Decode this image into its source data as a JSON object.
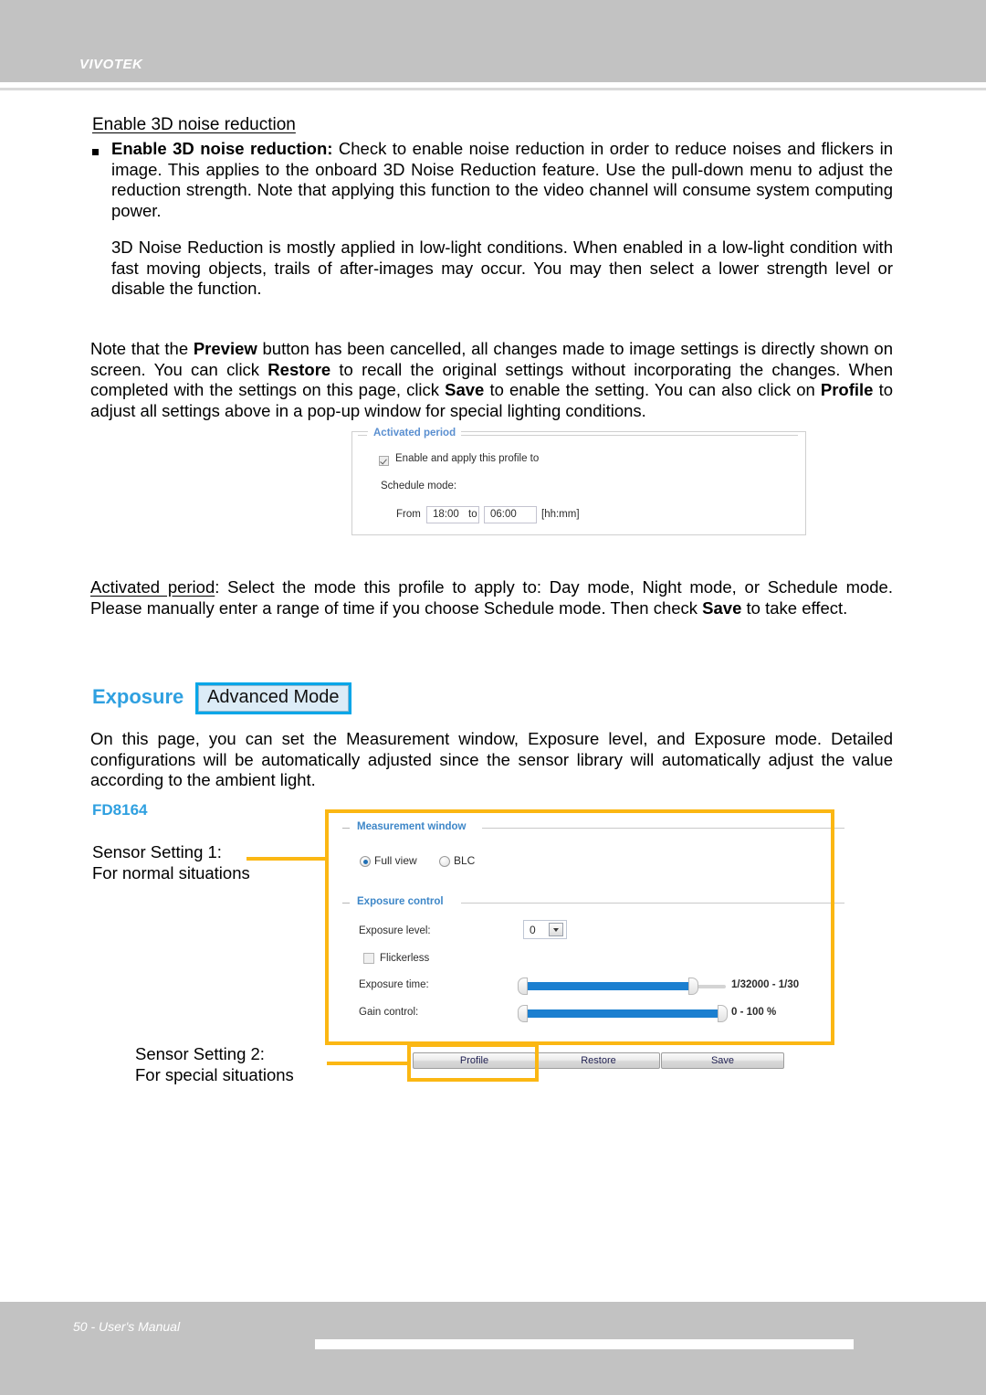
{
  "header": {
    "brand": "VIVOTEK"
  },
  "colors": {
    "header_gray": "#c2c2c2",
    "accent_blue": "#2fa0e0",
    "fieldset_blue": "#3e87c8",
    "annotation_yellow": "#fbb713",
    "slider_blue": "#1b7fd0",
    "badge_blue": "#00a6e8"
  },
  "content": {
    "section_heading": "Enable 3D noise reduction",
    "bullet_paragraph_lead": "Enable 3D noise reduction:",
    "bullet_paragraph_rest": " Check to enable noise reduction in order to reduce noises and flickers in image. This applies to the onboard 3D Noise Reduction feature. Use the pull-down menu to adjust the reduction strength. Note that applying this function to the video channel will consume system computing power.",
    "noise_reduction_paragraph": "3D Noise Reduction is mostly applied in low-light conditions. When enabled in a low-light condition with fast moving objects, trails of after-images may occur. You may then select a lower strength level or disable the function.",
    "note_paragraph": {
      "t1": "Note that the ",
      "b1": "Preview",
      "t2": " button has been cancelled, all changes made to image settings is directly shown on screen. You can click ",
      "b2": "Restore",
      "t3": " to recall the original settings without incorporating the changes. When completed with the settings on this page, click ",
      "b3": "Save",
      "t4": " to enable the setting. You can also click on ",
      "b4": "Profile",
      "t5": " to adjust all settings above in a pop-up window for special lighting conditions."
    },
    "activated_period_paragraph": {
      "u1": "Activated period",
      "t1": ": Select the mode this profile to apply to: Day mode, Night mode, or Schedule mode. Please manually enter a range of time if you choose Schedule mode. Then check ",
      "b1": "Save",
      "t2": " to take effect."
    },
    "exposure_paragraph": "On this page, you can set the Measurement window, Exposure level, and Exposure mode. Detailed configurations will be automatically adjusted since the sensor library will automatically adjust the value according to the ambient light."
  },
  "activated_period_dialog": {
    "legend": "Activated period",
    "enable_checkbox_label": "Enable and apply this profile to",
    "enable_checkbox_checked": true,
    "schedule_mode_label": "Schedule mode:",
    "from_label": "From",
    "from_value": "18:00",
    "to_label": "to",
    "to_value": "06:00",
    "format_hint": "[hh:mm]"
  },
  "exposure_section": {
    "title": "Exposure",
    "mode_badge": "Advanced Mode",
    "model": "FD8164"
  },
  "exposure_panel": {
    "measurement_window": {
      "legend": "Measurement window",
      "options": [
        {
          "label": "Full view",
          "selected": true
        },
        {
          "label": "BLC",
          "selected": false
        }
      ]
    },
    "exposure_control": {
      "legend": "Exposure control",
      "exposure_level_label": "Exposure level:",
      "exposure_level_value": "0",
      "flickerless_label": "Flickerless",
      "flickerless_checked": false,
      "exposure_time_label": "Exposure time:",
      "exposure_time_value": "1/32000 - 1/30",
      "gain_control_label": "Gain control:",
      "gain_control_value": "0 - 100 %"
    },
    "buttons": {
      "profile": "Profile",
      "restore": "Restore",
      "save": "Save"
    }
  },
  "annotations": {
    "sensor_setting_1_line1": "Sensor Setting 1:",
    "sensor_setting_1_line2": "For normal situations",
    "sensor_setting_2_line1": "Sensor Setting 2:",
    "sensor_setting_2_line2": "For special situations"
  },
  "footer": {
    "text": "50 - User's Manual"
  }
}
